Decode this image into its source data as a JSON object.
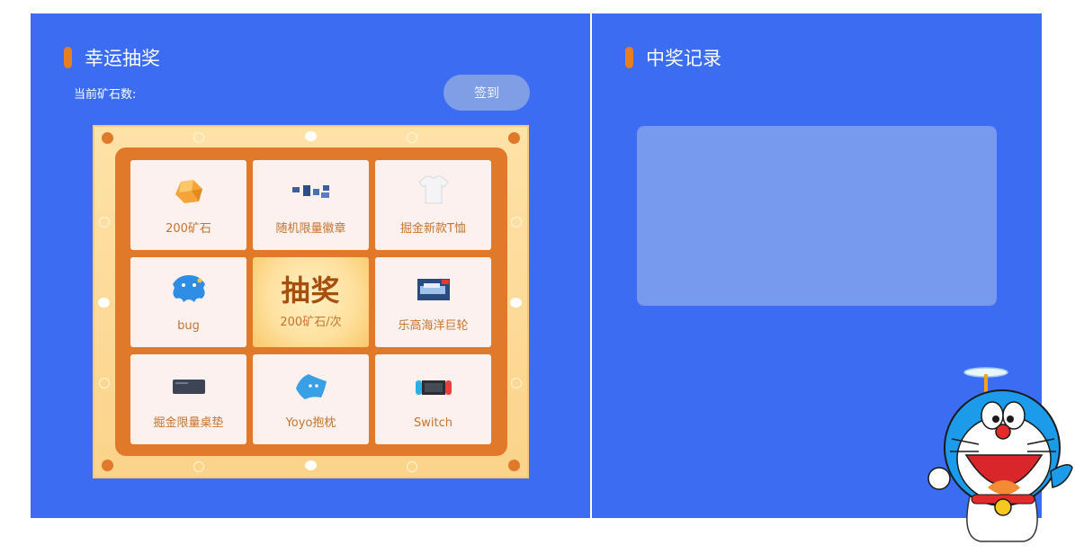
{
  "lottery": {
    "title": "幸运抽奖",
    "ore_label": "当前矿石数:",
    "checkin_label": "签到",
    "draw": {
      "title": "抽奖",
      "cost": "200矿石/次"
    },
    "prizes": [
      {
        "label": "200矿石",
        "icon": "ore-icon"
      },
      {
        "label": "随机限量徽章",
        "icon": "badges-icon"
      },
      {
        "label": "掘金新款T恤",
        "icon": "tshirt-icon"
      },
      {
        "label": "bug",
        "icon": "bug-icon"
      },
      {
        "label": "乐高海洋巨轮",
        "icon": "lego-box-icon"
      },
      {
        "label": "掘金限量桌垫",
        "icon": "desk-mat-icon"
      },
      {
        "label": "Yoyo抱枕",
        "icon": "yoyo-pillow-icon"
      },
      {
        "label": "Switch",
        "icon": "switch-console-icon"
      }
    ]
  },
  "records": {
    "title": "中奖记录"
  },
  "colors": {
    "panel": "#3b6cf2",
    "accent": "#e67e22",
    "board_inner": "#e07a2a",
    "cell": "#fdf1ef",
    "cell_text": "#c7742e"
  }
}
